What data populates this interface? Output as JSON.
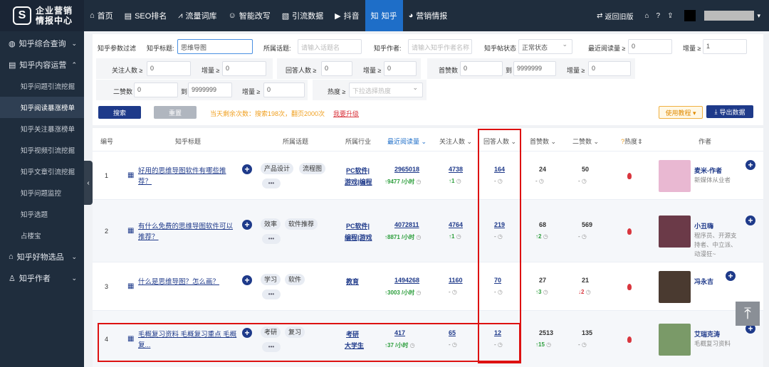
{
  "app": {
    "logo_text_1": "企业营销",
    "logo_text_2": "情报中心"
  },
  "topnav": [
    {
      "icon": "home-icon",
      "glyph": "⌂",
      "label": "首页"
    },
    {
      "icon": "seo-icon",
      "glyph": "▤",
      "label": "SEO排名"
    },
    {
      "icon": "chart-icon",
      "glyph": "⩘",
      "label": "流量词库"
    },
    {
      "icon": "robot-icon",
      "glyph": "☺",
      "label": "智能改写"
    },
    {
      "icon": "doc-icon",
      "glyph": "▧",
      "label": "引流数据"
    },
    {
      "icon": "video-icon",
      "glyph": "▶",
      "label": "抖音"
    },
    {
      "icon": "zhihu-icon",
      "glyph": "知",
      "label": "知乎"
    },
    {
      "icon": "chat-icon",
      "glyph": "◕",
      "label": "营销情报"
    }
  ],
  "topright": {
    "back_old": "返回旧版"
  },
  "sidebar": {
    "groups": [
      {
        "label": "知乎综合查询",
        "arrow": "⌄"
      },
      {
        "label": "知乎内容运营",
        "arrow": "⌃"
      },
      {
        "label": "知乎好物选品",
        "arrow": "⌄"
      },
      {
        "label": "知乎作者",
        "arrow": "⌄"
      }
    ],
    "items": [
      "知乎问题引流挖掘",
      "知乎阅读暴涨榜单",
      "知乎关注暴涨榜单",
      "知乎视频引流挖掘",
      "知乎文章引流挖掘",
      "知乎问题监控",
      "知乎选题",
      "占楼宝"
    ]
  },
  "filters": {
    "section_label": "知乎参数过滤",
    "title_label": "知乎标题:",
    "title_value": "思维导图",
    "topic_label": "所属话题:",
    "topic_placeholder": "请输入话题名",
    "author_label": "知乎作者:",
    "author_placeholder": "请输入知乎作者名称",
    "status_label": "知乎帖状态",
    "status_value": "正常状态",
    "recent_read_label": "最近阅读量 ≥",
    "recent_read_value": "0",
    "increase_label": "增量 ≥",
    "increase_value_1": "1",
    "follow_label": "关注人数 ≥",
    "follow_value": "0",
    "follow_inc_label": "增量 ≥",
    "follow_inc_value": "0",
    "answer_label": "回答人数 ≥",
    "answer_value": "0",
    "answer_inc_label": "增量 ≥",
    "answer_inc_value": "0",
    "like_label": "首赞数",
    "like_min": "0",
    "to": "到",
    "like_max": "9999999",
    "like_inc_label": "增量 ≥",
    "like_inc_value": "0",
    "second_like_label": "二赞数",
    "second_min": "0",
    "second_max": "9999999",
    "second_inc_label": "增量 ≥",
    "second_inc_value": "0",
    "heat_label": "热度 ≥",
    "heat_placeholder": "下拉选择热度",
    "search_btn": "搜索",
    "reset_btn": "重置",
    "remaining": "当天剩余次数：搜索198次，翻页2000次",
    "upgrade": "我要升级",
    "tutorial_btn": "使用教程 ▾",
    "export_btn": "导出数据"
  },
  "table": {
    "headers": [
      "编号",
      "知乎标题",
      "所属话题",
      "所属行业",
      "最近阅读量",
      "关注人数",
      "回答人数",
      "首赞数",
      "二赞数",
      "热度",
      "作者"
    ],
    "rows": [
      {
        "no": "1",
        "title": "好用的思维导图软件有哪些推荐？",
        "tags": [
          "产品设计",
          "流程图"
        ],
        "industry_1": "PC软件|",
        "industry_2": "游戏|编程",
        "read": "2965018",
        "read_up": "9477 /小时",
        "follow": "4738",
        "follow_up": "1",
        "answer": "164",
        "answer_sub": "-",
        "like1": "24",
        "like1_sub": "-",
        "like2": "50",
        "like2_sub": "-",
        "author": "麦米-作者",
        "desc": "新媒体从业者"
      },
      {
        "no": "2",
        "title": "有什么免费的思维导图软件可以推荐？",
        "tags": [
          "效率",
          "软件推荐"
        ],
        "industry_1": "PC软件|",
        "industry_2": "编程|游戏",
        "read": "4072811",
        "read_up": "8871 /小时",
        "follow": "4764",
        "follow_up": "1",
        "answer": "219",
        "answer_sub": "-",
        "like1": "68",
        "like1_sub": "2",
        "like2": "569",
        "like2_sub": "-",
        "author": "小丑嗨",
        "desc": "程序员、开源支持者、中立派、动漫狂~"
      },
      {
        "no": "3",
        "title": "什么是思维导图？怎么画？",
        "tags": [
          "学习",
          "软件"
        ],
        "industry_1": "教育",
        "industry_2": "",
        "read": "1494268",
        "read_up": "3003 /小时",
        "follow": "1160",
        "follow_up": "-",
        "answer": "70",
        "answer_sub": "-",
        "like1": "27",
        "like1_sub": "3",
        "like2": "21",
        "like2_sub": "2",
        "author": "冯永吉",
        "desc": ""
      },
      {
        "no": "4",
        "title": "毛概复习资料 毛概复习重点 毛概复...",
        "tags": [
          "考研",
          "复习"
        ],
        "industry_1": "考研",
        "industry_2": "大学生",
        "read": "417",
        "read_up": "37 /小时",
        "follow": "65",
        "follow_up": "-",
        "answer": "12",
        "answer_sub": "-",
        "like1": "2513",
        "like1_sub": "15",
        "like2": "135",
        "like2_sub": "-",
        "author": "艾瑞克涛",
        "desc": "毛概复习资料"
      }
    ]
  },
  "colors": {
    "topbar": "#1f2d3d",
    "accent": "#1e6ec8",
    "up": "#2a9d3a",
    "down": "#d9363e",
    "highlight": "#d11111"
  }
}
